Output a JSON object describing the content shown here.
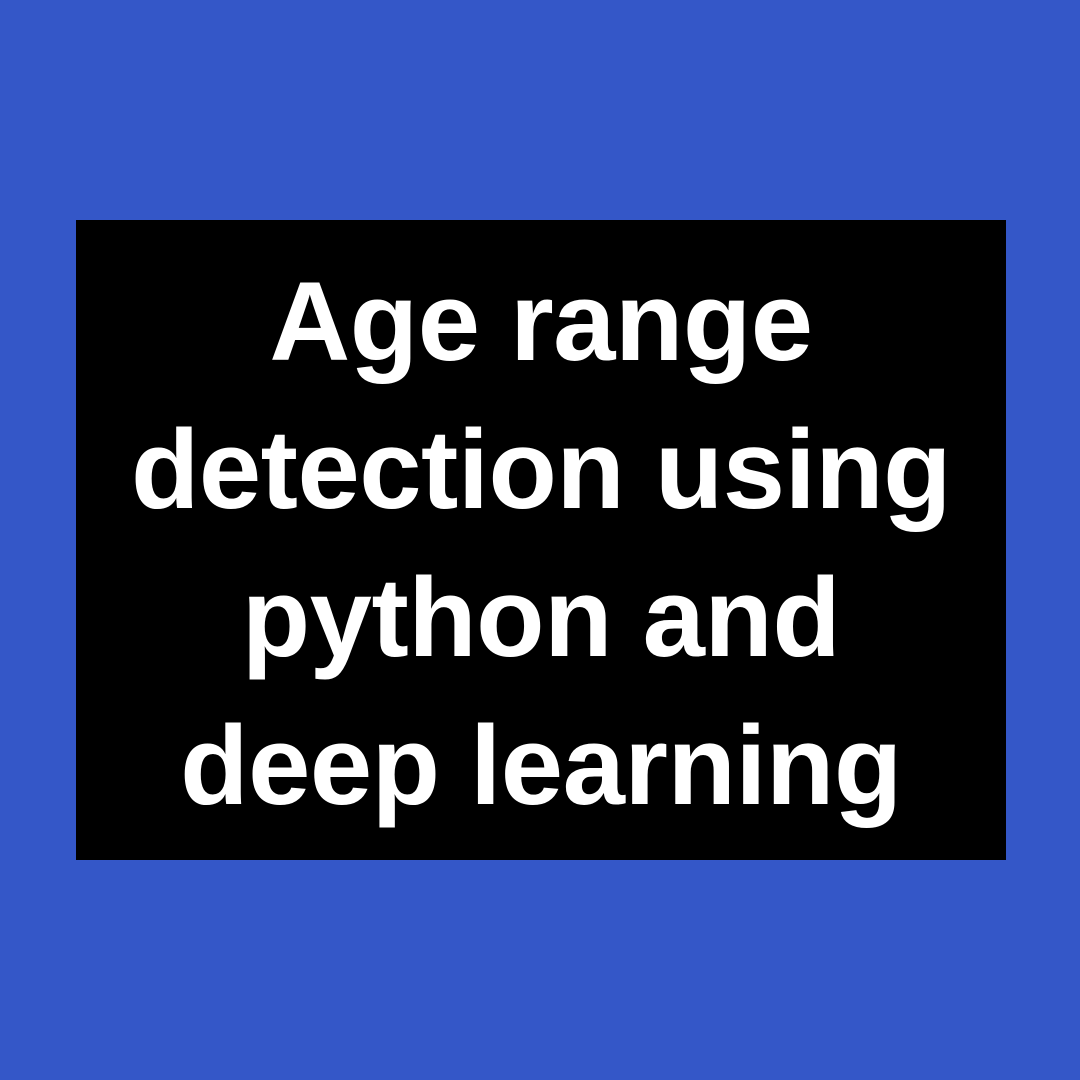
{
  "colors": {
    "background": "#3457c8",
    "card": "#000000",
    "text": "#ffffff"
  },
  "title": {
    "lines": [
      "Age range",
      "detection using",
      "python and",
      "deep learning"
    ]
  }
}
